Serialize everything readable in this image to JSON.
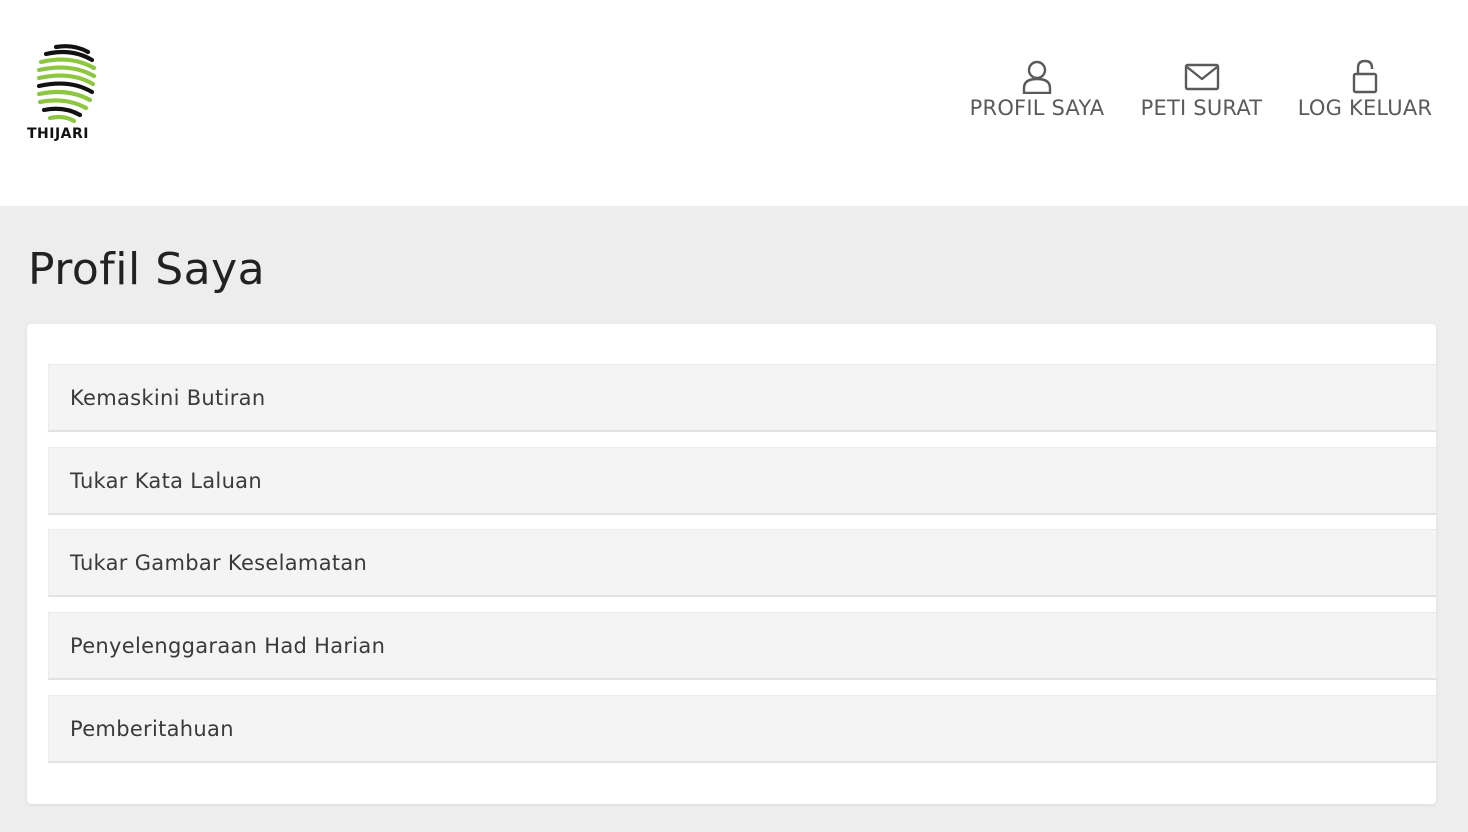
{
  "brand": {
    "logo_text": "THIJARI",
    "colors": {
      "green": "#8dc63f",
      "black": "#111111"
    }
  },
  "nav": {
    "items": [
      {
        "label": "PROFIL SAYA",
        "icon": "user-icon"
      },
      {
        "label": "PETI SURAT",
        "icon": "mail-icon"
      },
      {
        "label": "LOG KELUAR",
        "icon": "unlock-icon"
      }
    ]
  },
  "page": {
    "title": "Profil Saya"
  },
  "menu": {
    "items": [
      {
        "label": "Kemaskini Butiran"
      },
      {
        "label": "Tukar Kata Laluan"
      },
      {
        "label": "Tukar Gambar Keselamatan"
      },
      {
        "label": "Penyelenggaraan Had Harian"
      },
      {
        "label": "Pemberitahuan"
      }
    ]
  }
}
